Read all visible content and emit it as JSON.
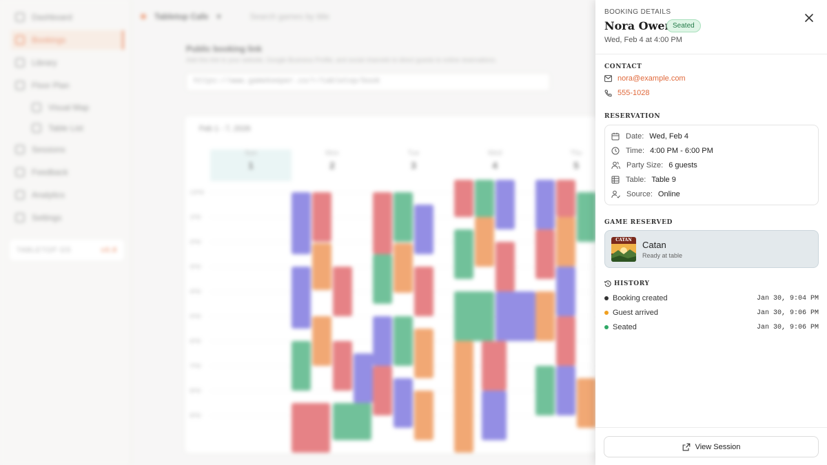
{
  "background": {
    "nav": [
      {
        "label": "Dashboard"
      },
      {
        "label": "Bookings"
      },
      {
        "label": "Library"
      },
      {
        "label": "Floor Plan"
      },
      {
        "label": "Visual Map"
      },
      {
        "label": "Table List"
      },
      {
        "label": "Sessions"
      },
      {
        "label": "Feedback"
      },
      {
        "label": "Analytics"
      },
      {
        "label": "Settings"
      }
    ],
    "promo": {
      "left": "TABLETOP OS",
      "right": "v0.8"
    },
    "topbar": {
      "venue": "Tabletop Cafe",
      "search_placeholder": "Search games by title"
    },
    "link_section": {
      "title": "Public booking link",
      "subtitle": "Add this link to your website, Google Business Profile, and social channels to direct guests to online reservations.",
      "url": "https://www.gamekeeper.co/r/tabletop/book"
    },
    "calendar": {
      "range": "Feb 1 - 7, 2026",
      "days": [
        {
          "name": "Sun",
          "num": "1"
        },
        {
          "name": "Mon",
          "num": "2"
        },
        {
          "name": "Tue",
          "num": "3"
        },
        {
          "name": "Wed",
          "num": "4"
        },
        {
          "name": "Thu",
          "num": "5"
        }
      ],
      "hours": [
        "12PM",
        "1PM",
        "2PM",
        "3PM",
        "4PM",
        "5PM",
        "6PM",
        "7PM",
        "8PM",
        "9PM"
      ]
    }
  },
  "panel": {
    "eyebrow": "BOOKING DETAILS",
    "guest_name": "Nora Owen",
    "status": "Seated",
    "when": "Wed, Feb 4 at 4:00 PM",
    "contact": {
      "heading": "CONTACT",
      "email": "nora@example.com",
      "phone": "555-1028"
    },
    "reservation": {
      "heading": "RESERVATION",
      "rows": [
        {
          "label": "Date:",
          "value": "Wed, Feb 4",
          "icon": "calendar-icon"
        },
        {
          "label": "Time:",
          "value": "4:00 PM - 6:00 PM",
          "icon": "clock-icon"
        },
        {
          "label": "Party Size:",
          "value": "6 guests",
          "icon": "users-icon"
        },
        {
          "label": "Table:",
          "value": "Table 9",
          "icon": "table-icon"
        },
        {
          "label": "Source:",
          "value": "Online",
          "icon": "user-source-icon"
        }
      ]
    },
    "game": {
      "heading": "GAME RESERVED",
      "name": "Catan",
      "status": "Ready at table",
      "thumb_text": "CATAN"
    },
    "history": {
      "heading": "HISTORY",
      "events": [
        {
          "label": "Booking created",
          "time": "Jan 30, 9:04 PM",
          "color": "#333333"
        },
        {
          "label": "Guest arrived",
          "time": "Jan 30, 9:06 PM",
          "color": "#f0a020"
        },
        {
          "label": "Seated",
          "time": "Jan 30, 9:06 PM",
          "color": "#2fa866"
        }
      ]
    },
    "view_session_label": "View Session"
  },
  "colors": {
    "accent": "#e0683a",
    "seated_bg": "#dff5e6",
    "seated_text": "#237a48"
  }
}
